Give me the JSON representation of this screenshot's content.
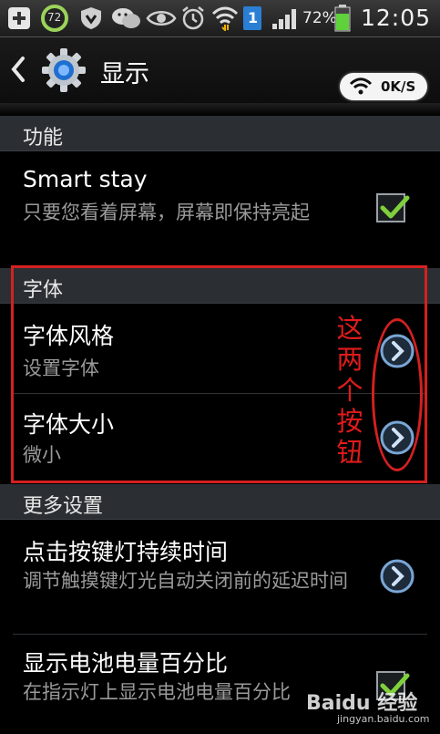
{
  "status_bar": {
    "notification_badge": "72",
    "battery_percent": "72%",
    "time": "12:05",
    "sim_badge": "1"
  },
  "action_bar": {
    "title": "显示",
    "network_speed": "0K/S"
  },
  "sections": {
    "features": {
      "header": "功能",
      "smart_stay": {
        "title": "Smart stay",
        "summary": "只要您看着屏幕，屏幕即保持亮起",
        "checked": true
      }
    },
    "font": {
      "header": "字体",
      "font_style": {
        "title": "字体风格",
        "summary": "设置字体"
      },
      "font_size": {
        "title": "字体大小",
        "summary": "微小"
      }
    },
    "more": {
      "header": "更多设置",
      "key_light": {
        "title": "点击按键灯持续时间",
        "summary": "调节触摸键灯光自动关闭前的延迟时间"
      },
      "battery_percent": {
        "title": "显示电池电量百分比",
        "summary": "在指示灯上显示电池电量百分比",
        "checked": true
      }
    }
  },
  "annotation": {
    "lines": [
      "这",
      "两",
      "个",
      "按",
      "钮"
    ]
  },
  "watermark": {
    "brand": "Baidu 经验",
    "url": "jingyan.baidu.com"
  },
  "colors": {
    "accent_check": "#7fd03c",
    "annotation_red": "#d42020",
    "section_header_bg": "#2b2f33",
    "battery_green": "#5fd13a",
    "sim_blue": "#2a7fd4"
  }
}
